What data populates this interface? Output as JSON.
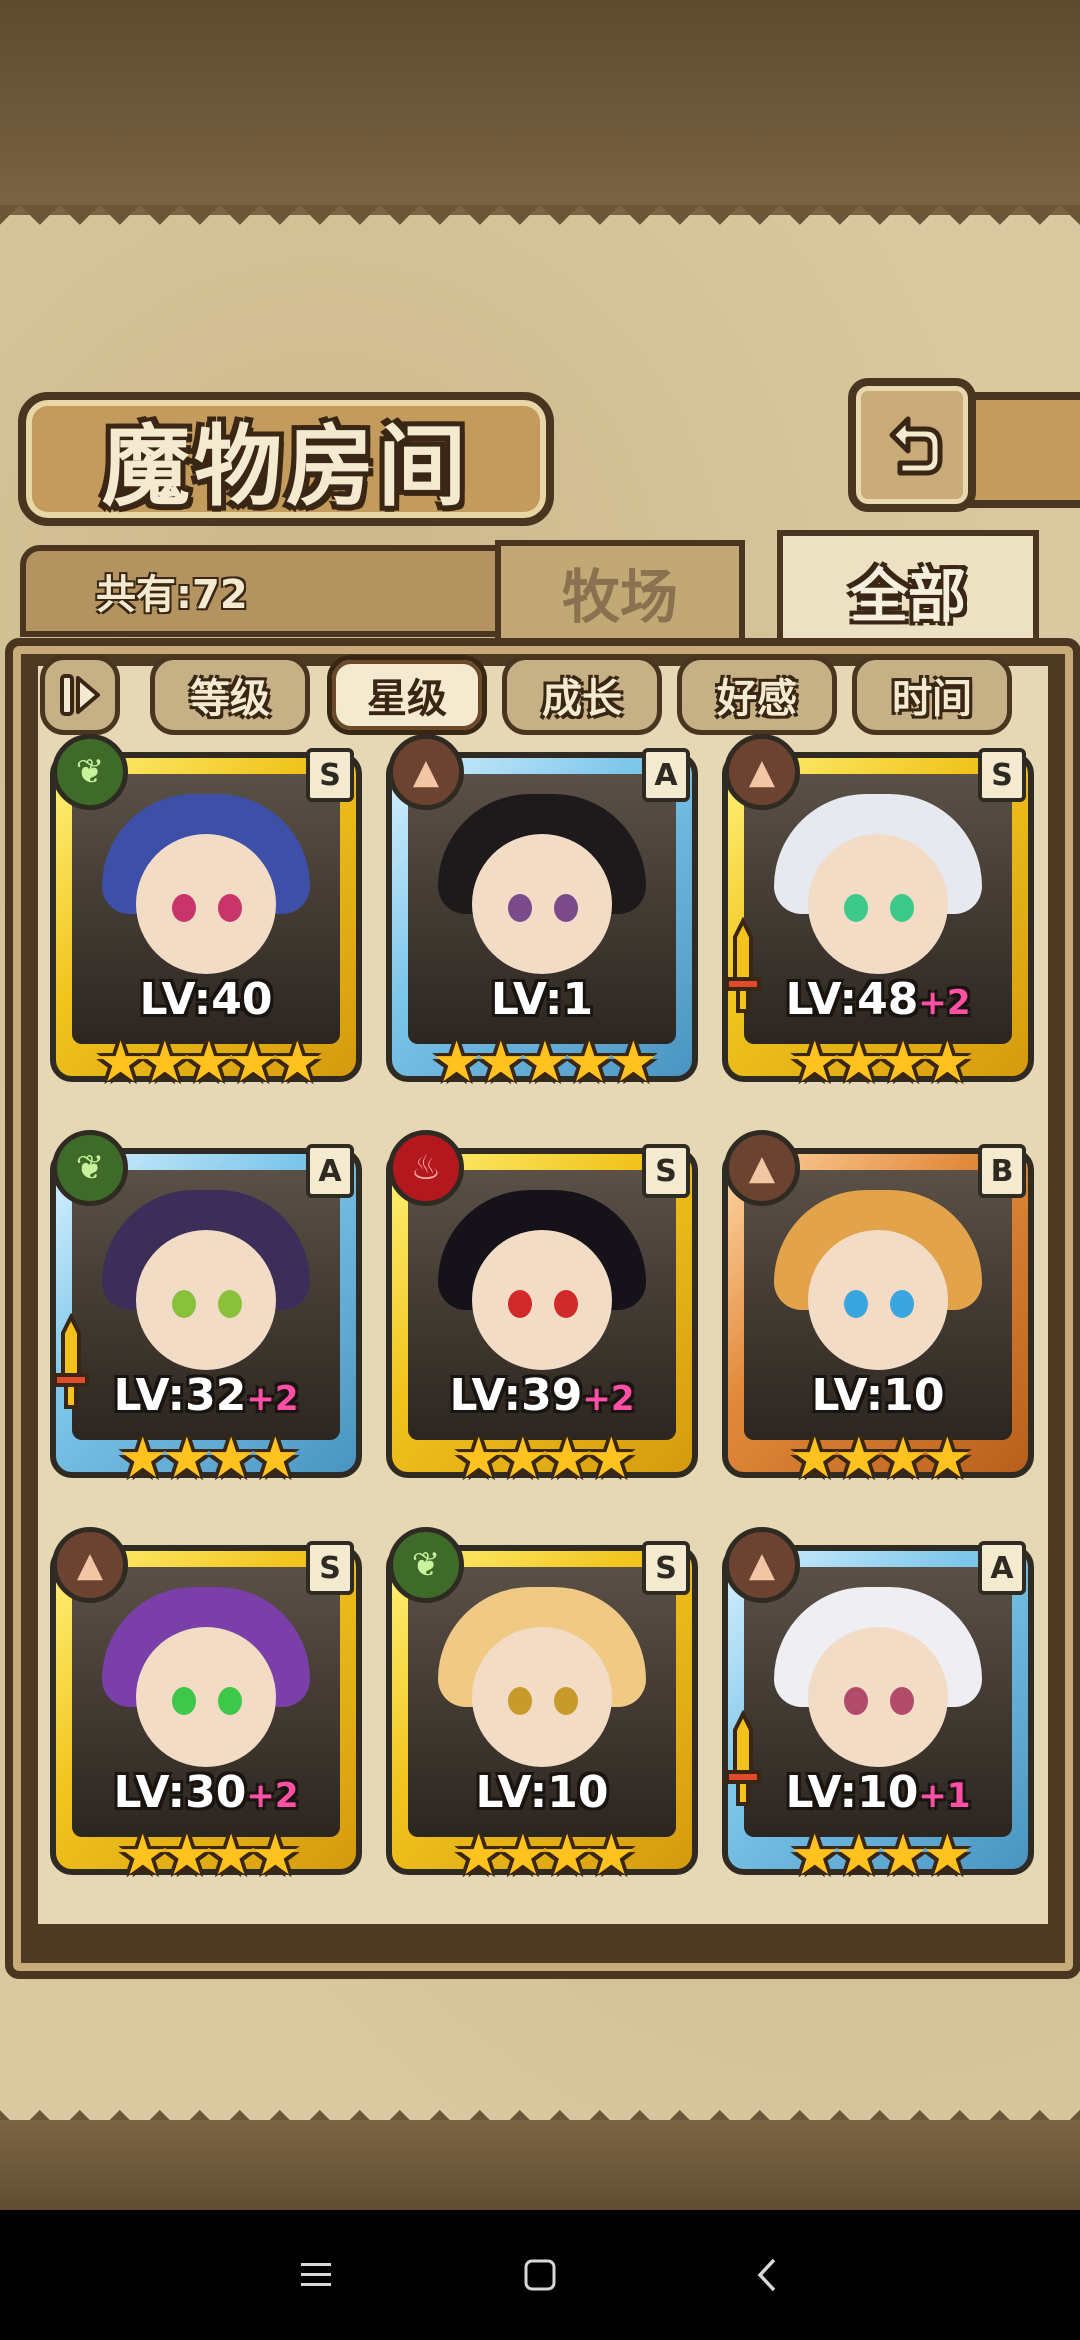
{
  "header": {
    "title": "魔物房间",
    "back_icon": "return-arrow-icon"
  },
  "summary": {
    "count_label": "共有:72"
  },
  "tabs": [
    {
      "label": "牧场",
      "active": false
    },
    {
      "label": "全部",
      "active": true
    }
  ],
  "filters": {
    "sort_icon": "sort-order-icon",
    "items": [
      {
        "label": "等级",
        "active": false
      },
      {
        "label": "星级",
        "active": true
      },
      {
        "label": "成长",
        "active": false
      },
      {
        "label": "好感",
        "active": false
      },
      {
        "label": "时间",
        "active": false
      }
    ]
  },
  "monsters": [
    {
      "level": "LV:40",
      "plus": "",
      "rank": "S",
      "element": "leaf",
      "stars": 5,
      "frame": "gold",
      "hair": "#3e4fa8",
      "eyes": "#c7356b",
      "weapon": false
    },
    {
      "level": "LV:1",
      "plus": "",
      "rank": "A",
      "element": "earth",
      "stars": 5,
      "frame": "blue",
      "hair": "#1e1a1c",
      "eyes": "#7a4a8a",
      "weapon": false
    },
    {
      "level": "LV:48",
      "plus": "+2",
      "rank": "S",
      "element": "earth",
      "stars": 4,
      "frame": "gold",
      "hair": "#e6e9ef",
      "eyes": "#3cc98a",
      "weapon": true
    },
    {
      "level": "LV:32",
      "plus": "+2",
      "rank": "A",
      "element": "leaf",
      "stars": 4,
      "frame": "blue",
      "hair": "#3b2e58",
      "eyes": "#89c23a",
      "weapon": true
    },
    {
      "level": "LV:39",
      "plus": "+2",
      "rank": "S",
      "element": "fire",
      "stars": 4,
      "frame": "gold",
      "hair": "#16121a",
      "eyes": "#d12a2a",
      "weapon": false
    },
    {
      "level": "LV:10",
      "plus": "",
      "rank": "B",
      "element": "earth",
      "stars": 4,
      "frame": "bronze",
      "hair": "#e3a34a",
      "eyes": "#3aa6e0",
      "weapon": false
    },
    {
      "level": "LV:30",
      "plus": "+2",
      "rank": "S",
      "element": "earth",
      "stars": 4,
      "frame": "gold",
      "hair": "#7a3fa8",
      "eyes": "#3ec84a",
      "weapon": false
    },
    {
      "level": "LV:10",
      "plus": "",
      "rank": "S",
      "element": "leaf",
      "stars": 4,
      "frame": "gold",
      "hair": "#f0c985",
      "eyes": "#c89a2a",
      "weapon": false
    },
    {
      "level": "LV:10",
      "plus": "+1",
      "rank": "A",
      "element": "earth",
      "stars": 4,
      "frame": "blue",
      "hair": "#eeeef3",
      "eyes": "#b24a6a",
      "weapon": true
    }
  ],
  "navbar": {
    "menu_icon": "menu-icon",
    "home_icon": "home-square-icon",
    "back_icon": "back-chevron-icon"
  }
}
